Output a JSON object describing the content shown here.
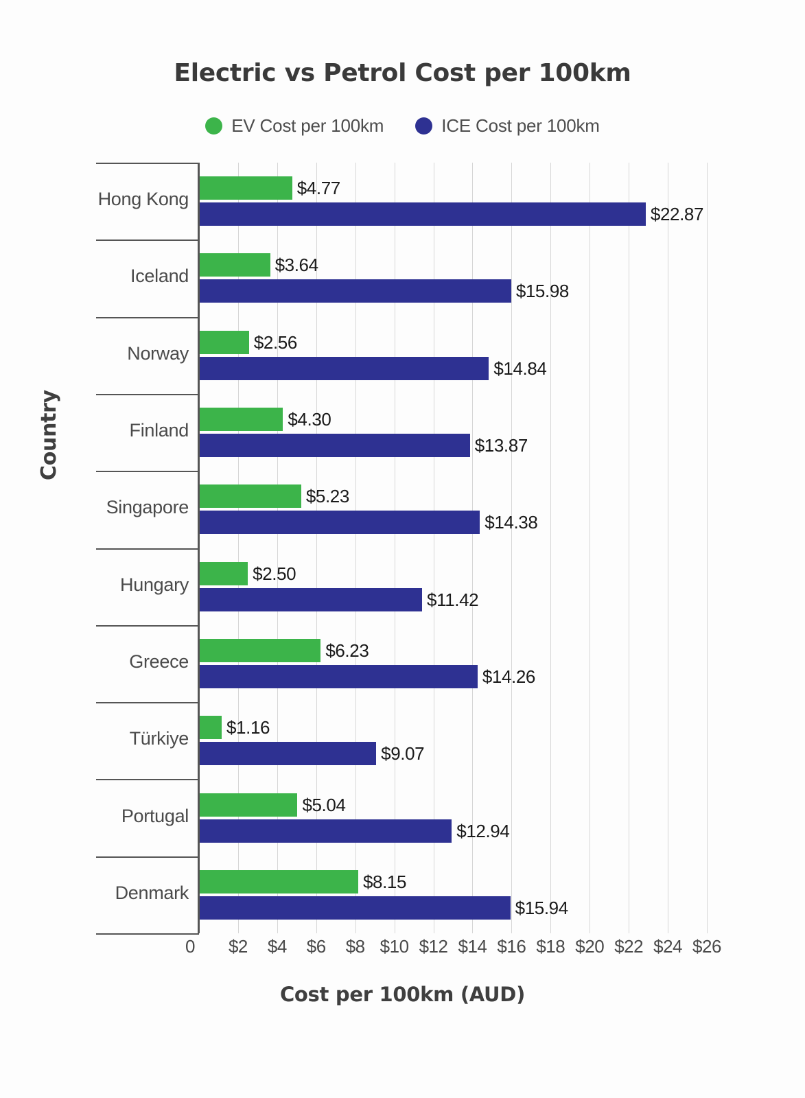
{
  "chart_data": {
    "type": "bar",
    "orientation": "horizontal",
    "title": "Electric vs Petrol Cost per 100km",
    "xlabel": "Cost per 100km (AUD)",
    "ylabel": "Country",
    "xlim": [
      0,
      26
    ],
    "grid": true,
    "legend_position": "top-center",
    "x_ticks": [
      "0",
      "$2",
      "$4",
      "$6",
      "$8",
      "$10",
      "$12",
      "$14",
      "$16",
      "$18",
      "$20",
      "$22",
      "$24",
      "$26"
    ],
    "x_tick_values": [
      0,
      2,
      4,
      6,
      8,
      10,
      12,
      14,
      16,
      18,
      20,
      22,
      24,
      26
    ],
    "categories": [
      "Hong Kong",
      "Iceland",
      "Norway",
      "Finland",
      "Singapore",
      "Hungary",
      "Greece",
      "Türkiye",
      "Portugal",
      "Denmark"
    ],
    "series": [
      {
        "name": "EV Cost per 100km",
        "color": "#3cb44a",
        "values": [
          4.77,
          3.64,
          2.56,
          4.3,
          5.23,
          2.5,
          6.23,
          1.16,
          5.04,
          8.15
        ],
        "labels": [
          "$4.77",
          "$3.64",
          "$2.56",
          "$4.30",
          "$5.23",
          "$2.50",
          "$6.23",
          "$1.16",
          "$5.04",
          "$8.15"
        ]
      },
      {
        "name": "ICE Cost per 100km",
        "color": "#2e3192",
        "values": [
          22.87,
          15.98,
          14.84,
          13.87,
          14.38,
          11.42,
          14.26,
          9.07,
          12.94,
          15.94
        ],
        "labels": [
          "$22.87",
          "$15.98",
          "$14.84",
          "$13.87",
          "$14.38",
          "$11.42",
          "$14.26",
          "$9.07",
          "$12.94",
          "$15.94"
        ]
      }
    ]
  },
  "legend": {
    "items": [
      {
        "label": "EV Cost per 100km",
        "color": "#3cb44a",
        "marker": "circle-marker"
      },
      {
        "label": "ICE Cost per 100km",
        "color": "#2e3192",
        "marker": "circle-marker"
      }
    ]
  },
  "axes": {
    "x_title": "Cost per 100km (AUD)",
    "y_title": "Country"
  },
  "colors": {
    "ev": "#3cb44a",
    "ice": "#2e3192",
    "grid": "#d6d6d6",
    "axis": "#555555",
    "text": "#4a4a4a",
    "title": "#3a3a3a",
    "background": "#fdfdfd"
  }
}
